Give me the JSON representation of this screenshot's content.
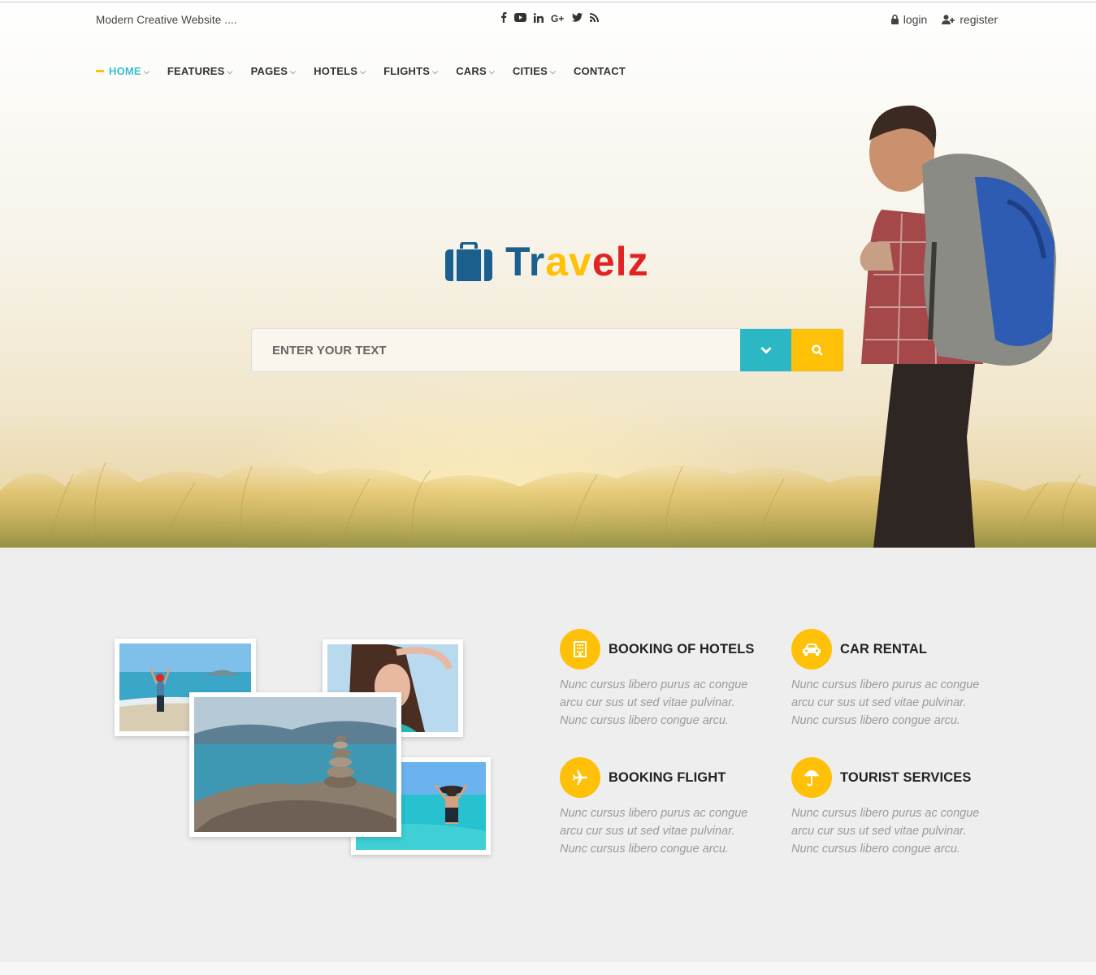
{
  "topbar": {
    "tagline": "Modern Creative Website ....",
    "socials": [
      {
        "icon": "facebook-icon",
        "glyph": "f"
      },
      {
        "icon": "youtube-icon",
        "glyph": "▶"
      },
      {
        "icon": "linkedin-icon",
        "glyph": "in"
      },
      {
        "icon": "google-plus-icon",
        "glyph": "G+"
      },
      {
        "icon": "twitter-icon",
        "glyph": "🐦"
      },
      {
        "icon": "rss-icon",
        "glyph": "⟟"
      }
    ],
    "login_label": "login",
    "register_label": "register"
  },
  "nav": {
    "items": [
      {
        "label": "HOME",
        "active": true,
        "dropdown": true
      },
      {
        "label": "FEATURES",
        "dropdown": true
      },
      {
        "label": "PAGES",
        "dropdown": true
      },
      {
        "label": "HOTELS",
        "dropdown": true
      },
      {
        "label": "FLIGHTS",
        "dropdown": true
      },
      {
        "label": "CARS",
        "dropdown": true
      },
      {
        "label": "CITIES",
        "dropdown": true
      },
      {
        "label": "CONTACT",
        "dropdown": false
      }
    ]
  },
  "logo": {
    "part1": "Tr",
    "part2": "av",
    "part3": "elz"
  },
  "search": {
    "placeholder": "ENTER YOUR TEXT"
  },
  "features": [
    {
      "title": "BOOKING OF HOTELS",
      "icon": "hotel-icon",
      "desc": "Nunc cursus libero purus ac congue arcu cur sus ut sed vitae pulvinar. Nunc cursus libero congue arcu."
    },
    {
      "title": "CAR RENTAL",
      "icon": "car-icon",
      "desc": "Nunc cursus libero purus ac congue arcu cur sus ut sed vitae pulvinar. Nunc cursus libero congue arcu."
    },
    {
      "title": "BOOKING FLIGHT",
      "icon": "plane-icon",
      "desc": "Nunc cursus libero purus ac congue arcu cur sus ut sed vitae pulvinar. Nunc cursus libero congue arcu."
    },
    {
      "title": "TOURIST SERVICES",
      "icon": "umbrella-icon",
      "desc": "Nunc cursus libero purus ac congue arcu cur sus ut sed vitae pulvinar. Nunc cursus libero congue arcu."
    }
  ],
  "colors": {
    "accent": "#ffc107",
    "teal": "#2bb7c4",
    "navy": "#1a5f8e",
    "red": "#e02424"
  }
}
